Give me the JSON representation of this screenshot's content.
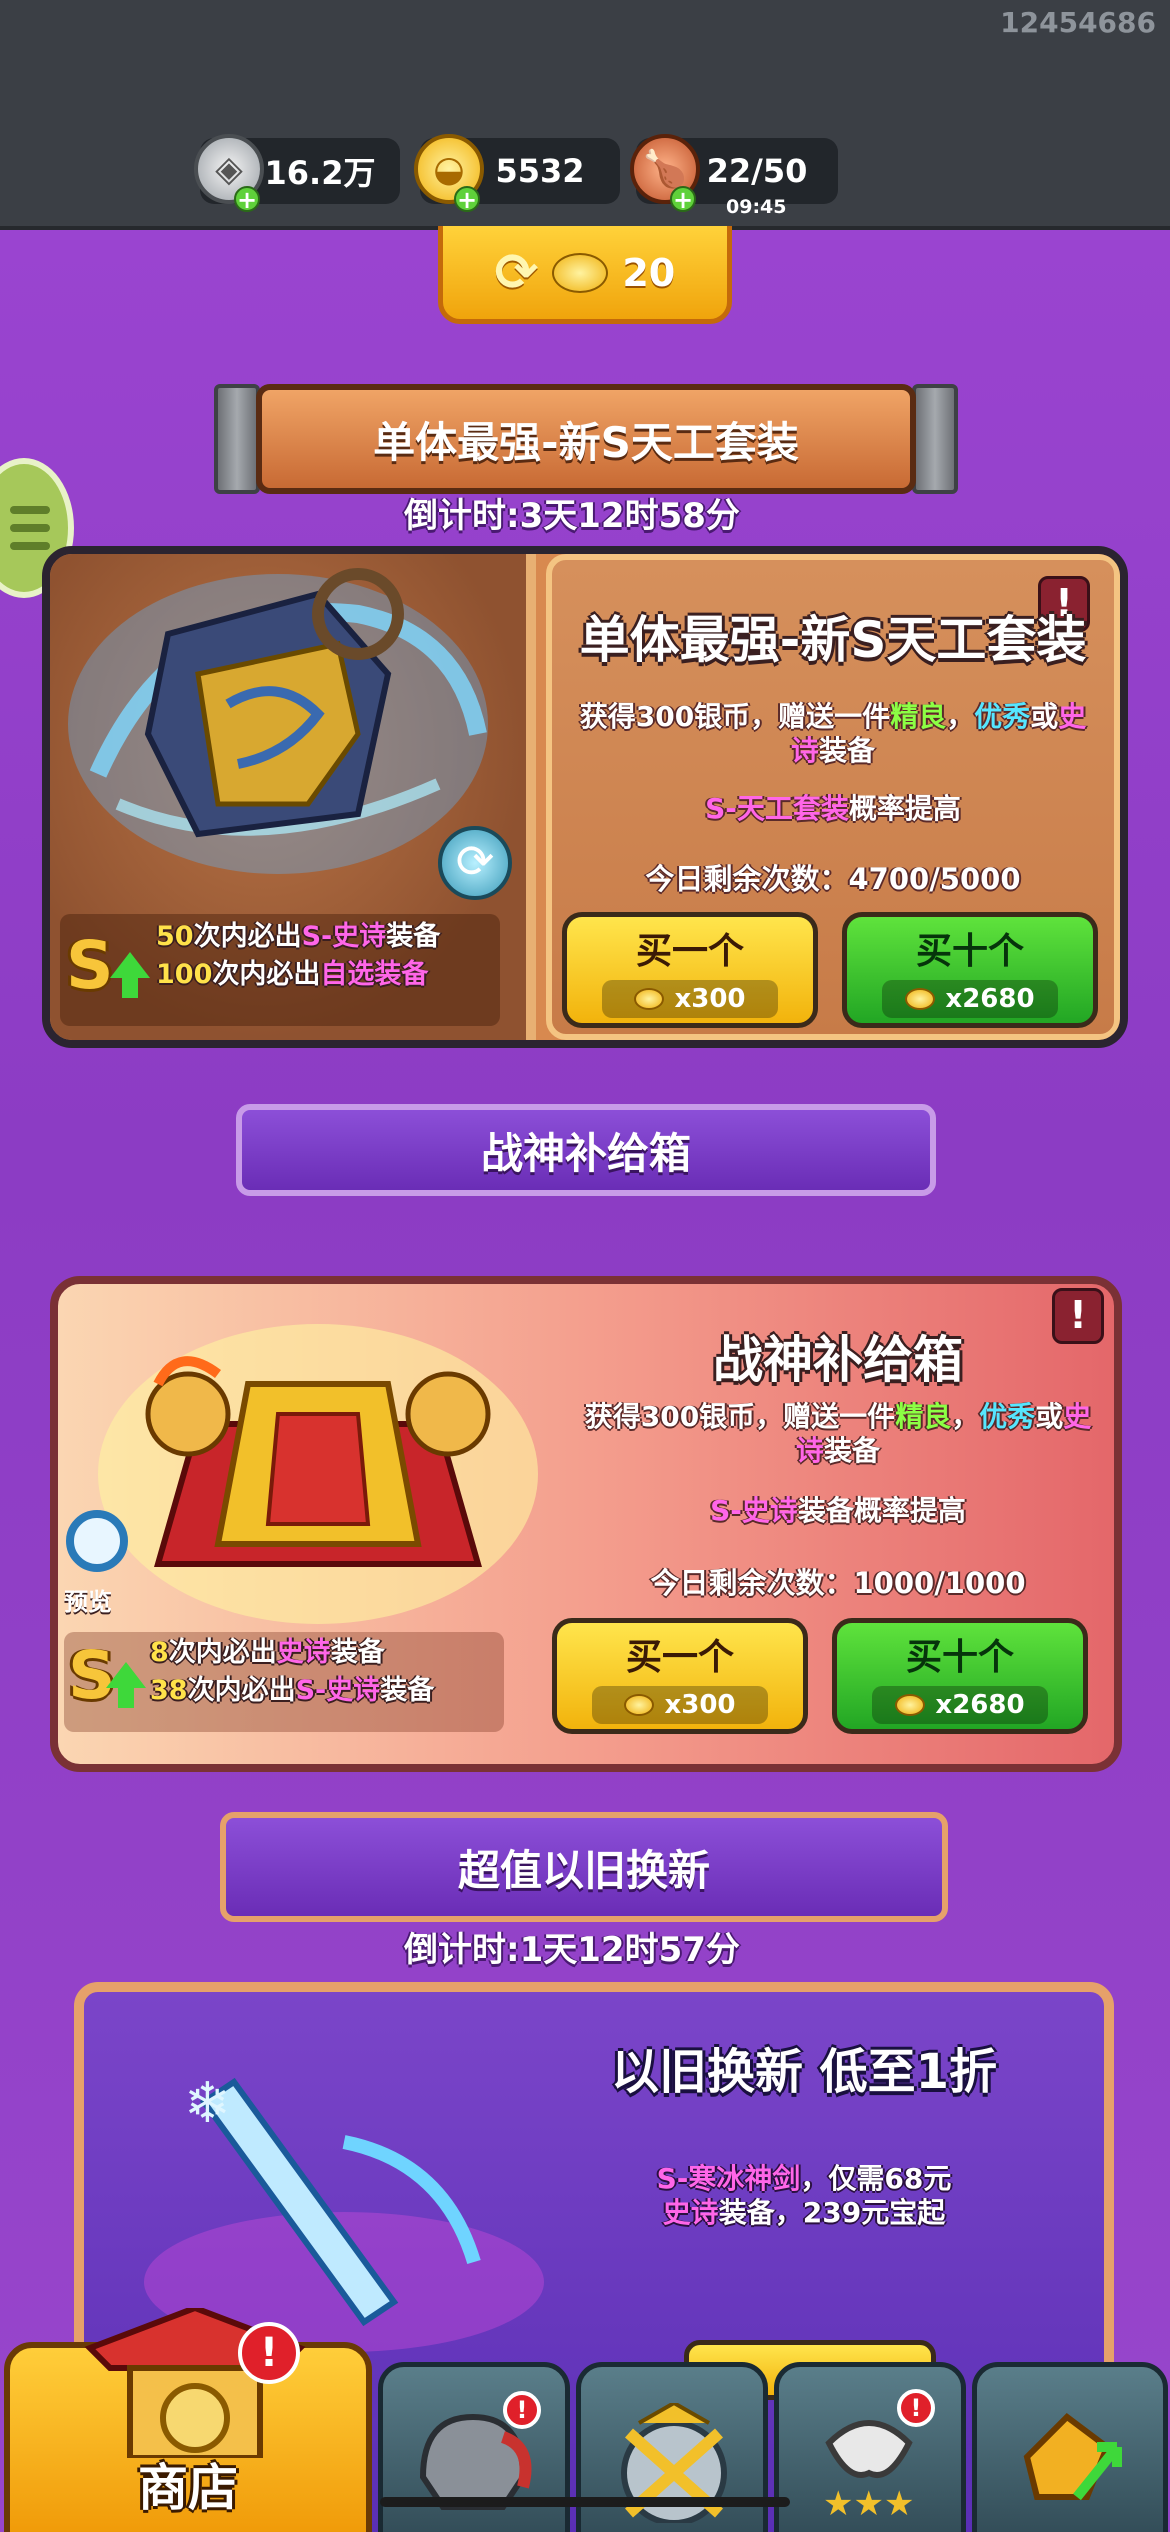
{
  "header": {
    "uid": "12454686",
    "resources": [
      {
        "icon": "silver-coin-icon",
        "value": "16.2万"
      },
      {
        "icon": "gold-ingot-icon",
        "value": "5532"
      },
      {
        "icon": "meat-drumstick-icon",
        "value": "22/50",
        "sub": "09:45"
      }
    ]
  },
  "refresh": {
    "icon": "refresh-icon",
    "value": "20"
  },
  "banner1": {
    "title": "单体最强-新S天工套装",
    "countdown": "倒计时:3天12时58分",
    "card_title": "单体最强-新S天工套装",
    "desc_a": "获得300银币，赠送一件",
    "desc_green": "精良",
    "desc_comma": "，",
    "desc_cyan": "优秀",
    "desc_or": "或",
    "desc_pink": "史诗",
    "desc_end": "装备",
    "boost_pink": "S-天工套装",
    "boost_end": "概率提高",
    "remaining": "今日剩余次数：4700/5000",
    "pity1_num": "50",
    "pity1_text": "次内必出",
    "pity1_item": "S-史诗",
    "pity1_end": "装备",
    "pity2_num": "100",
    "pity2_text": "次内必出",
    "pity2_item": "自选装备",
    "buy_one": "买一个",
    "buy_one_cost": "x300",
    "buy_ten": "买十个",
    "buy_ten_cost": "x2680"
  },
  "section2": {
    "header": "战神补给箱",
    "card_title": "战神补给箱",
    "desc_a": "获得300银币，赠送一件",
    "desc_green": "精良",
    "desc_comma": "，",
    "desc_cyan": "优秀",
    "desc_or": "或",
    "desc_pink": "史诗",
    "desc_end": "装备",
    "boost_pink": "S-史诗",
    "boost_end": "装备概率提高",
    "remaining": "今日剩余次数：1000/1000",
    "preview": "预览",
    "pity1_num": "8",
    "pity1_text": "次内必出",
    "pity1_item": "史诗",
    "pity1_end": "装备",
    "pity2_num": "38",
    "pity2_text": "次内必出",
    "pity2_item": "S-史诗",
    "pity2_end": "装备",
    "buy_one": "买一个",
    "buy_one_cost": "x300",
    "buy_ten": "买十个",
    "buy_ten_cost": "x2680"
  },
  "section3": {
    "header": "超值以旧换新",
    "countdown": "倒计时:1天12时57分",
    "card_title": "以旧换新 低至1折",
    "line1_pink": "S-寒冰神剑",
    "line1_end": "，仅需68元",
    "line2_pink": "史诗",
    "line2_end": "装备，239元宝起"
  },
  "nav": {
    "shop_label": "商店",
    "tabs": [
      "helmet-icon",
      "sword-shield-icon",
      "wing-stars-icon",
      "upgrade-ore-icon"
    ]
  }
}
